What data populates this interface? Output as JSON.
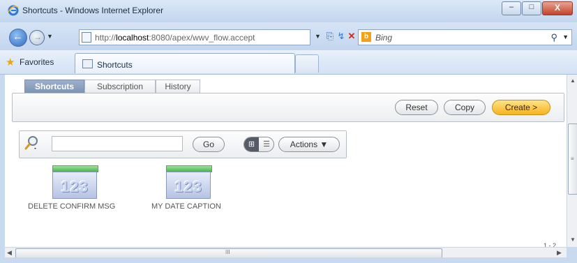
{
  "window": {
    "title": "Shortcuts - Windows Internet Explorer",
    "controls": {
      "minimize": "–",
      "maximize": "□",
      "close": "X"
    }
  },
  "address_bar": {
    "url_prefix": "http://",
    "url_host": "localhost",
    "url_path": ":8080/apex/wwv_flow.accept",
    "search_placeholder": "Bing",
    "search_logo": "b"
  },
  "favorites_bar": {
    "favorites_label": "Favorites",
    "tab_label": "Shortcuts"
  },
  "apex": {
    "tabs": [
      {
        "label": "Shortcuts",
        "active": true
      },
      {
        "label": "Subscription",
        "active": false
      },
      {
        "label": "History",
        "active": false
      }
    ],
    "buttons": {
      "reset": "Reset",
      "copy": "Copy",
      "create": "Create >"
    },
    "search": {
      "value": "",
      "go": "Go",
      "actions": "Actions ▼"
    },
    "shortcuts": [
      {
        "name": "DELETE CONFIRM MSG",
        "icon": "123"
      },
      {
        "name": "MY DATE CAPTION",
        "icon": "123"
      }
    ]
  },
  "scrollbars": {
    "hgrip": "III",
    "vgrip": "≡"
  },
  "colors": {
    "create_accent": "#f6b21e",
    "active_tab": "#7b93b4",
    "icon_bar": "#48b44a"
  }
}
